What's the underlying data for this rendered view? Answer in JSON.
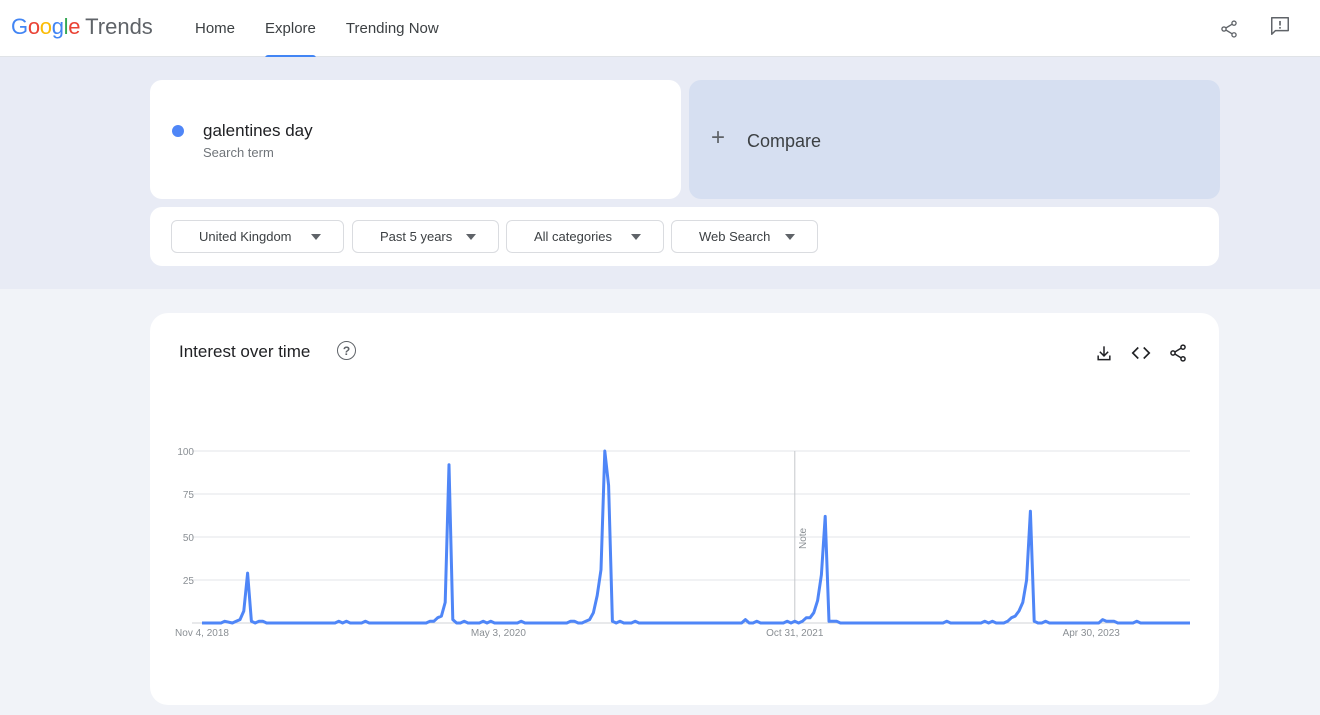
{
  "header": {
    "logo_google": "Google",
    "logo_trends": "Trends",
    "nav": [
      {
        "label": "Home",
        "active": false
      },
      {
        "label": "Explore",
        "active": true
      },
      {
        "label": "Trending Now",
        "active": false
      }
    ],
    "icons": [
      "share-icon",
      "feedback-icon"
    ]
  },
  "search": {
    "term": "galentines day",
    "term_sub": "Search term",
    "term_color": "#4f86f7",
    "compare_label": "Compare"
  },
  "filters": [
    {
      "label": "United Kingdom"
    },
    {
      "label": "Past 5 years"
    },
    {
      "label": "All categories"
    },
    {
      "label": "Web Search"
    }
  ],
  "chart_card": {
    "title": "Interest over time",
    "help": "?",
    "icons": [
      "download-icon",
      "embed-icon",
      "share-icon"
    ]
  },
  "chart_data": {
    "type": "line",
    "ylim": [
      0,
      100
    ],
    "yticks": [
      25,
      50,
      75,
      100
    ],
    "grid": true,
    "xlabels": [
      "Nov 4, 2018",
      "May 3, 2020",
      "Oct 31, 2021",
      "Apr 30, 2023"
    ],
    "note_label": "Note",
    "note_week": 156,
    "total_weeks": 260,
    "color": "#4f86f7",
    "series": [
      {
        "points": [
          [
            0,
            0
          ],
          [
            5,
            0
          ],
          [
            6,
            1
          ],
          [
            8,
            0
          ],
          [
            9,
            1
          ],
          [
            10,
            2
          ],
          [
            11,
            7
          ],
          [
            12,
            29
          ],
          [
            13,
            1
          ],
          [
            14,
            0
          ],
          [
            15,
            1
          ],
          [
            16,
            1
          ],
          [
            17,
            0
          ],
          [
            18,
            0
          ],
          [
            35,
            0
          ],
          [
            36,
            1
          ],
          [
            37,
            0
          ],
          [
            38,
            1
          ],
          [
            39,
            0
          ],
          [
            42,
            0
          ],
          [
            43,
            1
          ],
          [
            44,
            0
          ],
          [
            59,
            0
          ],
          [
            60,
            1
          ],
          [
            61,
            1
          ],
          [
            62,
            3
          ],
          [
            63,
            4
          ],
          [
            64,
            12
          ],
          [
            65,
            92
          ],
          [
            66,
            2
          ],
          [
            67,
            0
          ],
          [
            68,
            0
          ],
          [
            69,
            1
          ],
          [
            70,
            0
          ],
          [
            73,
            0
          ],
          [
            74,
            1
          ],
          [
            75,
            0
          ],
          [
            76,
            1
          ],
          [
            77,
            0
          ],
          [
            83,
            0
          ],
          [
            84,
            1
          ],
          [
            85,
            0
          ],
          [
            96,
            0
          ],
          [
            97,
            1
          ],
          [
            98,
            1
          ],
          [
            99,
            0
          ],
          [
            100,
            0
          ],
          [
            101,
            1
          ],
          [
            102,
            2
          ],
          [
            103,
            6
          ],
          [
            104,
            16
          ],
          [
            105,
            31
          ],
          [
            106,
            100
          ],
          [
            107,
            80
          ],
          [
            108,
            1
          ],
          [
            109,
            0
          ],
          [
            110,
            1
          ],
          [
            111,
            0
          ],
          [
            113,
            0
          ],
          [
            114,
            1
          ],
          [
            115,
            0
          ],
          [
            142,
            0
          ],
          [
            143,
            2
          ],
          [
            144,
            0
          ],
          [
            145,
            0
          ],
          [
            146,
            1
          ],
          [
            147,
            0
          ],
          [
            153,
            0
          ],
          [
            154,
            1
          ],
          [
            155,
            0
          ],
          [
            156,
            1
          ],
          [
            157,
            0
          ],
          [
            158,
            1
          ],
          [
            159,
            3
          ],
          [
            160,
            3
          ],
          [
            161,
            6
          ],
          [
            162,
            13
          ],
          [
            163,
            28
          ],
          [
            164,
            62
          ],
          [
            165,
            1
          ],
          [
            166,
            1
          ],
          [
            167,
            1
          ],
          [
            168,
            0
          ],
          [
            195,
            0
          ],
          [
            196,
            1
          ],
          [
            197,
            0
          ],
          [
            205,
            0
          ],
          [
            206,
            1
          ],
          [
            207,
            0
          ],
          [
            208,
            1
          ],
          [
            209,
            0
          ],
          [
            211,
            0
          ],
          [
            212,
            1
          ],
          [
            213,
            3
          ],
          [
            214,
            4
          ],
          [
            215,
            7
          ],
          [
            216,
            12
          ],
          [
            217,
            25
          ],
          [
            218,
            65
          ],
          [
            219,
            1
          ],
          [
            220,
            0
          ],
          [
            221,
            0
          ],
          [
            222,
            1
          ],
          [
            223,
            0
          ],
          [
            236,
            0
          ],
          [
            237,
            2
          ],
          [
            238,
            1
          ],
          [
            239,
            1
          ],
          [
            240,
            1
          ],
          [
            241,
            0
          ],
          [
            245,
            0
          ],
          [
            246,
            1
          ],
          [
            247,
            0
          ],
          [
            260,
            0
          ]
        ]
      }
    ]
  }
}
